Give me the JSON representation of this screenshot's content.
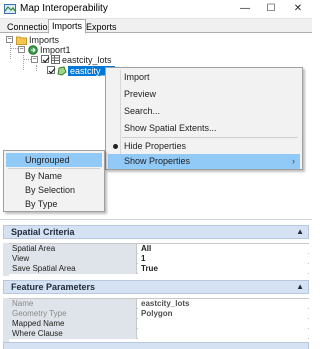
{
  "window": {
    "title": "Map Interoperability",
    "minimize": "—",
    "maximize": "☐",
    "close": "✕"
  },
  "tabs": [
    {
      "label": "Connections",
      "active": false
    },
    {
      "label": "Imports",
      "active": true
    },
    {
      "label": "Exports",
      "active": false
    }
  ],
  "tree": {
    "root": {
      "label": "Imports",
      "toggle": "−"
    },
    "import": {
      "label": "Import1",
      "toggle": "−"
    },
    "layer": {
      "label": "eastcity_lots",
      "toggle": "−"
    },
    "feature": {
      "label": "eastcity_lo"
    }
  },
  "context_menu": {
    "items": [
      {
        "label": "Import"
      },
      {
        "label": "Preview"
      },
      {
        "label": "Search..."
      },
      {
        "label": "Show Spatial Extents..."
      },
      {
        "label": "Hide Properties",
        "checked": true
      },
      {
        "label": "Show Properties",
        "arrow": "›",
        "highlighted": true
      }
    ]
  },
  "submenu": {
    "items": [
      {
        "label": "Ungrouped",
        "highlighted": true
      },
      {
        "label": "By Name"
      },
      {
        "label": "By Selection"
      },
      {
        "label": "By Type"
      }
    ]
  },
  "spatial_criteria": {
    "title": "Spatial Criteria",
    "collapse": "▲",
    "rows": [
      {
        "name": "Spatial Area",
        "value": "All"
      },
      {
        "name": "View",
        "value": "1"
      },
      {
        "name": "Save Spatial Area",
        "value": "True"
      }
    ]
  },
  "feature_parameters": {
    "title": "Feature Parameters",
    "collapse": "▲",
    "rows": [
      {
        "name": "Name",
        "value": "eastcity_lots",
        "disabled": true
      },
      {
        "name": "Geometry Type",
        "value": "Polygon",
        "disabled": true
      },
      {
        "name": "Mapped Name",
        "value": ""
      },
      {
        "name": "Where Clause",
        "value": ""
      }
    ]
  },
  "colors": {
    "selection": "#0078d7",
    "menu_highlight": "#91c9f7",
    "panel_header": "#d4e2f3"
  }
}
